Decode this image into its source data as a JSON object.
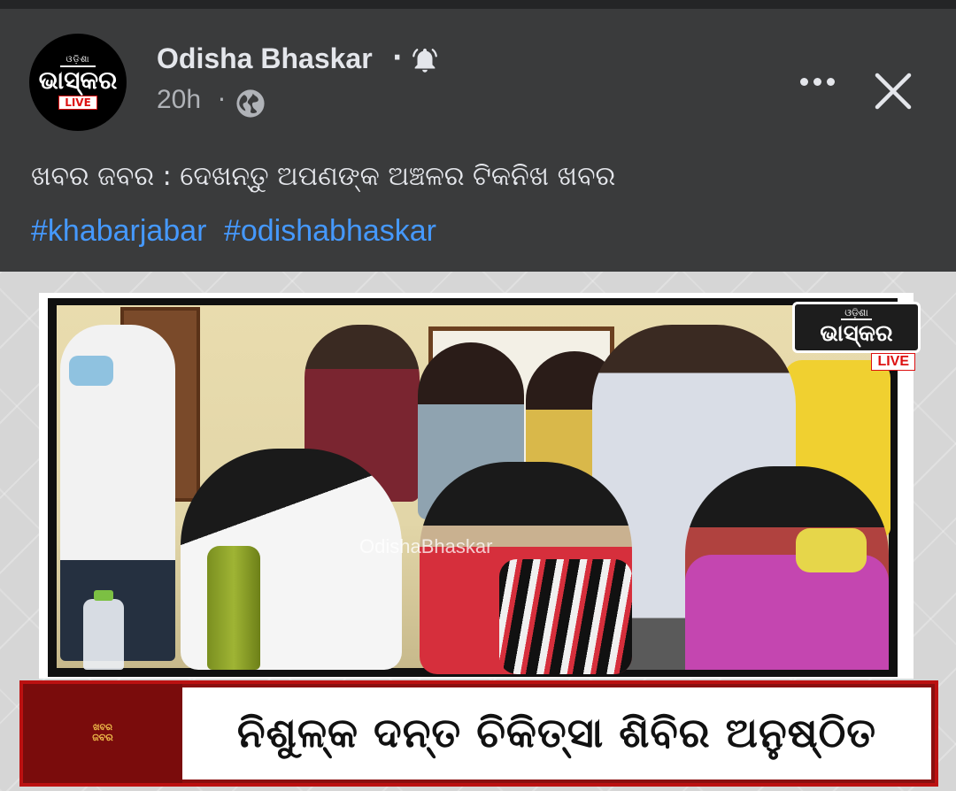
{
  "post": {
    "page_name": "Odisha Bhaskar",
    "separator": "·",
    "time": "20h",
    "time_separator": "·",
    "caption": "ଖବର ଜବର : ଦେଖନ୍ତୁ ଅପଣଙ୍କ ଅଞ୍ଚଳର ଟିକନିଖ ଖବର",
    "hashtags": [
      "#khabarjabar",
      "#odishabhaskar"
    ]
  },
  "avatar_logo": {
    "small_text": "ଓଡ଼ିଶା",
    "main_text": "ଭାସ୍କର",
    "live": "LIVE"
  },
  "media": {
    "watermark": "OdishaBhaskar",
    "corner_logo": {
      "small_text": "ଓଡ଼ିଶା",
      "main_text": "ଭାସ୍କର",
      "live": "LIVE"
    },
    "banner": {
      "brand_small": "ଖବର",
      "brand_main": "ଜବର",
      "headline": "ନିଶୁଳ୍କ ଦନ୍ତ ଚିକିତ୍ସା  ଶିବିର ଅନୁଷ୍ଠିତ"
    }
  },
  "icons": {
    "bell": "bell-icon",
    "globe": "globe-icon",
    "more": "more-horizontal-icon",
    "close": "close-icon"
  },
  "colors": {
    "background": "#3a3b3c",
    "text": "#e4e6eb",
    "secondary_text": "#b0b3b8",
    "hashtag": "#4599ff",
    "banner_red": "#8a1010"
  }
}
